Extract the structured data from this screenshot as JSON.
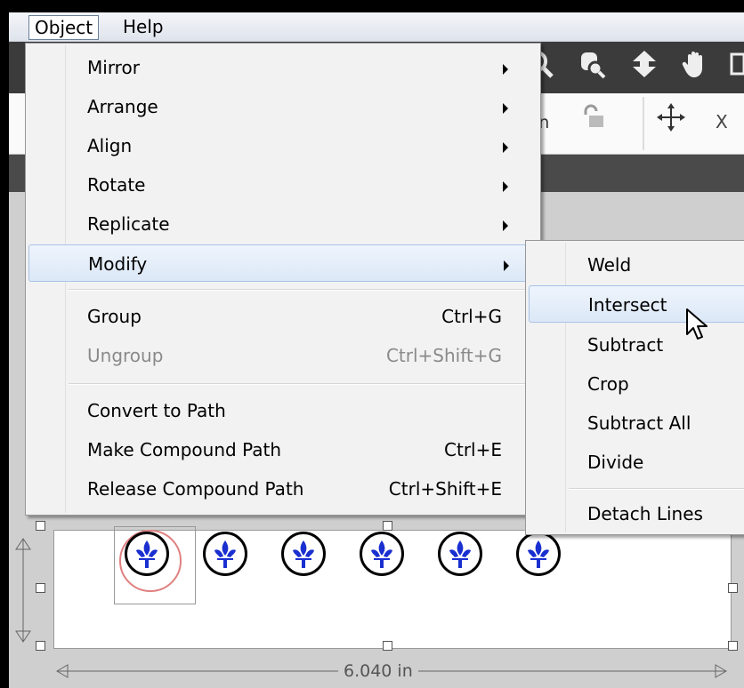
{
  "menubar": {
    "object_label": "Object",
    "help_label": "Help"
  },
  "toolbar": {
    "icons": [
      "zoom-out-icon",
      "zoom-fit-icon",
      "move-down-icon",
      "pan-hand-icon"
    ]
  },
  "optbar": {
    "unit": "in",
    "x_label": "X"
  },
  "canvas": {
    "width_dimension": "6.040 in",
    "items_count_shown": "6"
  },
  "menu": {
    "items": [
      {
        "label": "Mirror",
        "submenu": true
      },
      {
        "label": "Arrange",
        "submenu": true
      },
      {
        "label": "Align",
        "submenu": true
      },
      {
        "label": "Rotate",
        "submenu": true
      },
      {
        "label": "Replicate",
        "submenu": true
      },
      {
        "label": "Modify",
        "submenu": true,
        "highlighted": true
      },
      {
        "label": "Group",
        "shortcut": "Ctrl+G"
      },
      {
        "label": "Ungroup",
        "shortcut": "Ctrl+Shift+G",
        "disabled": true
      },
      {
        "label": "Convert to Path"
      },
      {
        "label": "Make Compound Path",
        "shortcut": "Ctrl+E"
      },
      {
        "label": "Release Compound Path",
        "shortcut": "Ctrl+Shift+E"
      }
    ]
  },
  "submenu": {
    "items": [
      {
        "label": "Weld"
      },
      {
        "label": "Intersect",
        "highlighted": true
      },
      {
        "label": "Subtract"
      },
      {
        "label": "Crop"
      },
      {
        "label": "Subtract All"
      },
      {
        "label": "Divide"
      },
      {
        "label": "Detach Lines"
      }
    ]
  },
  "colors": {
    "menu_highlight": "#dce8f7",
    "fleur_blue": "#1a2fd0",
    "toolbar_bg": "#3b3b3b"
  }
}
